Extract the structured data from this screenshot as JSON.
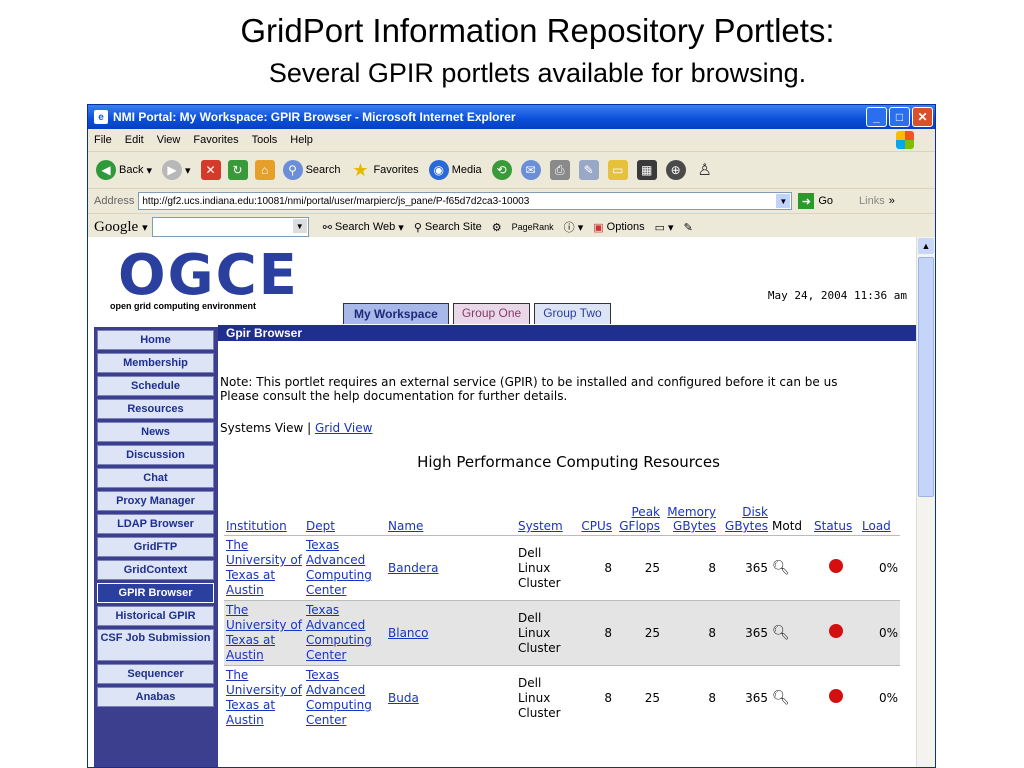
{
  "slide": {
    "title": "GridPort Information Repository Portlets:",
    "subtitle": "Several GPIR portlets available for browsing."
  },
  "browser": {
    "window_title": "NMI Portal: My Workspace: GPIR Browser - Microsoft Internet Explorer",
    "menu": [
      "File",
      "Edit",
      "View",
      "Favorites",
      "Tools",
      "Help"
    ],
    "toolbar": {
      "back": "Back",
      "search": "Search",
      "favorites": "Favorites",
      "media": "Media"
    },
    "address_label": "Address",
    "url": "http://gf2.ucs.indiana.edu:10081/nmi/portal/user/marpierc/js_pane/P-f65d7d2ca3-10003",
    "go": "Go",
    "links": "Links",
    "google": {
      "logo": "Google",
      "search_web": "Search Web",
      "search_site": "Search Site",
      "pagerank": "PageRank",
      "options": "Options"
    }
  },
  "portal": {
    "logo": "OGCE",
    "logo_sub": "open grid computing environment",
    "datetime": "May 24, 2004 11:36 am",
    "tabs": [
      "My Workspace",
      "Group One",
      "Group Two"
    ],
    "portlet_title": "Gpir Browser",
    "nav": [
      "Home",
      "Membership",
      "Schedule",
      "Resources",
      "News",
      "Discussion",
      "Chat",
      "Proxy Manager",
      "LDAP Browser",
      "GridFTP",
      "GridContext",
      "GPIR Browser",
      "Historical GPIR",
      "CSF Job Submission",
      "Sequencer",
      "Anabas"
    ],
    "note_line1": "Note: This portlet requires an external service (GPIR) to be installed and configured before it can be us",
    "note_line2": "Please consult the help documentation for further details.",
    "systems_view": "Systems View |",
    "grid_view": "Grid View",
    "table_title": "High Performance Computing Resources",
    "headers": {
      "institution": "Institution",
      "dept": "Dept",
      "name": "Name",
      "system": "System",
      "cpus": "CPUs",
      "peak": "Peak",
      "gflops": "GFlops",
      "memory": "Memory",
      "mem_gbytes": "GBytes",
      "disk": "Disk",
      "disk_gbytes": "GBytes",
      "motd": "Motd",
      "status": "Status",
      "load": "Load"
    },
    "rows": [
      {
        "institution": "The University of Texas at Austin",
        "dept": "Texas Advanced Computing Center",
        "name": "Bandera",
        "system": "Dell Linux Cluster",
        "cpus": "8",
        "gflops": "25",
        "memory": "8",
        "disk": "365",
        "load": "0%"
      },
      {
        "institution": "The University of Texas at Austin",
        "dept": "Texas Advanced Computing Center",
        "name": "Blanco",
        "system": "Dell Linux Cluster",
        "cpus": "8",
        "gflops": "25",
        "memory": "8",
        "disk": "365",
        "load": "0%"
      },
      {
        "institution": "The University of Texas at Austin",
        "dept": "Texas Advanced Computing Center",
        "name": "Buda",
        "system": "Dell Linux Cluster",
        "cpus": "8",
        "gflops": "25",
        "memory": "8",
        "disk": "365",
        "load": "0%"
      }
    ]
  }
}
